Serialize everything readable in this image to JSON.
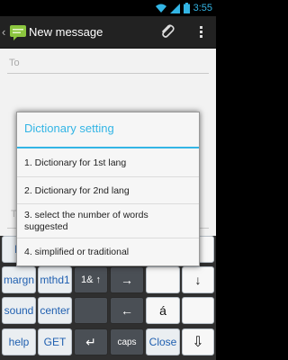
{
  "status_bar": {
    "time": "3:55",
    "icons": [
      "wifi-icon",
      "signal-icon",
      "battery-icon"
    ]
  },
  "action_bar": {
    "title": "New message",
    "icons": [
      "back-caret-icon",
      "messaging-app-icon",
      "paperclip-icon",
      "overflow-menu-icon"
    ]
  },
  "compose": {
    "to_placeholder": "To"
  },
  "dialog": {
    "title": "Dictionary setting",
    "items": [
      "1. Dictionary for 1st lang",
      "2. Dictionary for 2nd lang",
      "3. select the number of words suggested",
      "4. simplified or traditional"
    ]
  },
  "keyboard": {
    "row1": [
      "la",
      "l"
    ],
    "row2": [
      "margn",
      "mthd1",
      "1& ↑",
      "→",
      "",
      "↓"
    ],
    "row3": [
      "sound",
      "center",
      "",
      "←",
      "á",
      ""
    ],
    "row4": [
      "help",
      "GET",
      "↵",
      "caps",
      "Close",
      "⇩"
    ]
  },
  "colors": {
    "accent": "#33b5e5",
    "key_text_blue": "#1f5fb0",
    "action_bar": "#222222"
  }
}
